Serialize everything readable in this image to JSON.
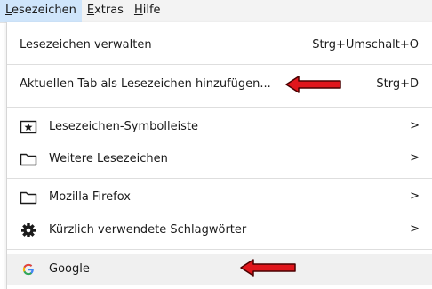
{
  "menubar": {
    "items": [
      {
        "accel": "L",
        "rest": "esezeichen"
      },
      {
        "accel": "E",
        "rest": "xtras"
      },
      {
        "accel": "H",
        "rest": "ilfe"
      }
    ]
  },
  "menu": {
    "manage": {
      "label": "Lesezeichen verwalten",
      "shortcut": "Strg+Umschalt+O"
    },
    "add_tab": {
      "label": "Aktuellen Tab als Lesezeichen hinzufügen...",
      "shortcut": "Strg+D"
    },
    "toolbar": {
      "label": "Lesezeichen-Symbolleiste",
      "icon": "star-box-icon"
    },
    "other": {
      "label": "Weitere Lesezeichen",
      "icon": "folder-icon"
    },
    "mozilla": {
      "label": "Mozilla Firefox",
      "icon": "folder-icon"
    },
    "recent_tags": {
      "label": "Kürzlich verwendete Schlagwörter",
      "icon": "gear-icon"
    },
    "google": {
      "label": "Google",
      "icon": "google-icon"
    },
    "chevron": ">"
  },
  "colors": {
    "arrow_fill": "#e0161c",
    "arrow_outline": "#4a0000",
    "menubar_active": "#cfe5fb"
  }
}
